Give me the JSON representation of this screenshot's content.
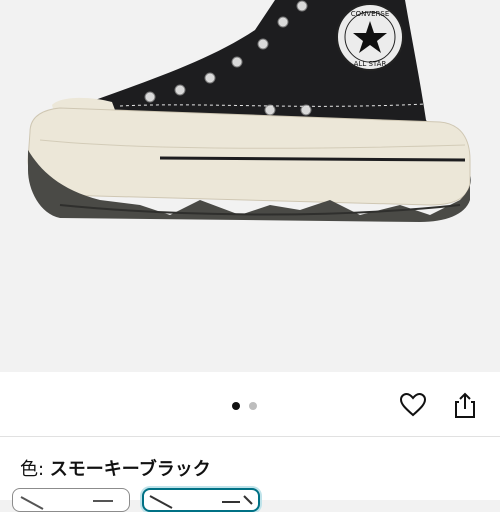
{
  "product_image": {
    "alt_icon": "converse-all-star-sneaker-image",
    "patch_text_top": "CONVERSE",
    "patch_text_bottom": "ALL STAR",
    "colors": {
      "canvas": "#1d1d1f",
      "rubber": "#ece7d8",
      "sole": "#4a4a46",
      "background": "#f2f2f2"
    }
  },
  "carousel": {
    "total": 2,
    "active_index": 0
  },
  "actions": {
    "wishlist_icon": "heart-icon",
    "share_icon": "share-icon"
  },
  "color_selector": {
    "label": "色: ",
    "selected_value": "スモーキーブラック",
    "selected_index": 1,
    "accent": "#007185"
  }
}
